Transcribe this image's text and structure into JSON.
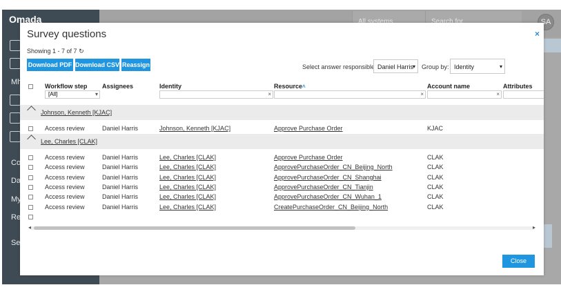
{
  "background": {
    "logo": "Omada",
    "nav_labels": [
      "Mh",
      "Co",
      "Da",
      "My",
      "Re",
      "Se"
    ],
    "systems_select": "All systems",
    "search_placeholder": "Search for...",
    "avatar_initials": "SA"
  },
  "modal": {
    "title": "Survey questions",
    "close_icon": "×",
    "showing": "Showing 1 - 7 of 7",
    "refresh_icon": "↻",
    "buttons": {
      "download_pdf": "Download PDF",
      "download_csv": "Download CSV",
      "reassign": "Reassign"
    },
    "responsible_label": "Select answer responsible",
    "responsible_value": "Daniel Harris",
    "groupby_label": "Group by:",
    "groupby_value": "Identity",
    "columns": {
      "workflow_step": "Workflow step",
      "assignees": "Assignees",
      "identity": "Identity",
      "resource": "Resource",
      "account_name": "Account name",
      "attributes": "Attributes"
    },
    "sort_icon": "˄",
    "workflow_filter": "[All]",
    "clear_icon": "×",
    "groups": [
      {
        "label": "Johnson, Kenneth [KJAC]",
        "rows": [
          {
            "step": "Access review",
            "assignee": "Daniel Harris",
            "identity": "Johnson, Kenneth [KJAC]",
            "resource": "Approve Purchase Order",
            "account": "KJAC"
          }
        ]
      },
      {
        "label": "Lee, Charles [CLAK]",
        "rows": [
          {
            "step": "Access review",
            "assignee": "Daniel Harris",
            "identity": "Lee, Charles [CLAK]",
            "resource": "Approve Purchase Order",
            "account": "CLAK"
          },
          {
            "step": "Access review",
            "assignee": "Daniel Harris",
            "identity": "Lee, Charles [CLAK]",
            "resource": "ApprovePurchaseOrder_CN_Beijing_North",
            "account": "CLAK"
          },
          {
            "step": "Access review",
            "assignee": "Daniel Harris",
            "identity": "Lee, Charles [CLAK]",
            "resource": "ApprovePurchaseOrder_CN_Shanghai",
            "account": "CLAK"
          },
          {
            "step": "Access review",
            "assignee": "Daniel Harris",
            "identity": "Lee, Charles [CLAK]",
            "resource": "ApprovePurchaseOrder_CN_Tianjin",
            "account": "CLAK"
          },
          {
            "step": "Access review",
            "assignee": "Daniel Harris",
            "identity": "Lee, Charles [CLAK]",
            "resource": "ApprovePurchaseOrder_CN_Wuhan_1",
            "account": "CLAK"
          },
          {
            "step": "Access review",
            "assignee": "Daniel Harris",
            "identity": "Lee, Charles [CLAK]",
            "resource": "CreatePurchaseOrder_CN_Beijing_North",
            "account": "CLAK"
          }
        ]
      }
    ],
    "close_button": "Close"
  },
  "colors": {
    "accent": "#2196e0",
    "sidebar": "#3f4b54"
  }
}
